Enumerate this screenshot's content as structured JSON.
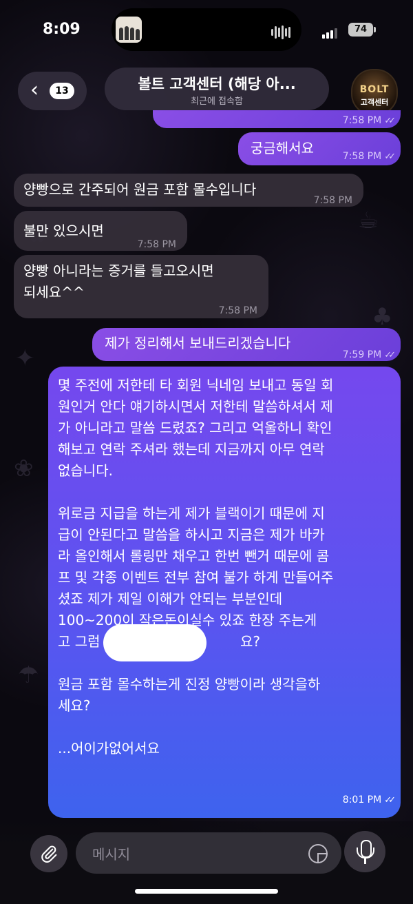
{
  "status_bar": {
    "time": "8:09",
    "battery": "74"
  },
  "header": {
    "back_count": "13",
    "title": "볼트 고객센터 (해당 아...",
    "subtitle": "최근에 접속함",
    "avatar_text_top": "BOLT",
    "avatar_text_bottom": "고객센터"
  },
  "messages": [
    {
      "dir": "out",
      "text": "",
      "time": "7:58 PM",
      "read": true
    },
    {
      "dir": "out",
      "text": "궁금해서요",
      "time": "7:58 PM",
      "read": true
    },
    {
      "dir": "in",
      "text": "양빵으로 간주되어 원금 포함 몰수입니다",
      "time": "7:58 PM"
    },
    {
      "dir": "in",
      "text": "불만 있으시면",
      "time": "7:58 PM"
    },
    {
      "dir": "in",
      "text_line1": "양빵 아니라는 증거를 들고오시면",
      "text_line2": "되세요^^",
      "time": "7:58 PM"
    },
    {
      "dir": "out",
      "text": "제가 정리해서 보내드리겠습니다",
      "time": "7:59 PM",
      "read": true
    },
    {
      "dir": "out",
      "paragraphs": [
        "몇 주전에 저한테 타 회원 닉네임 보내고 동일 회\n원인거 안다 얘기하시면서 저한테 말씀하셔서 제\n가 아니라고 말씀 드렸죠? 그리고 억울하니 확인\n해보고 연락 주셔라 했는데 지금까지 아무 연락\n없습니다.",
        "위로금 지급을 하는게 제가 블랙이기 때문에 지\n급이 안된다고 말씀을 하시고 지금은 제가 바카\n라 올인해서 롤링만 채우고 한번 뺀거 때문에 콤\n프 및 각종 이벤트 전부 참여 불가 하게 만들어주\n셨죠 제가 제일 이해가 안되는 부분인데\n100~200이 작은돈이실수 있죠 한장 주는게\n고 그럼                                요?",
        "원금 포함 몰수하는게 진정 양빵이라 생각을하\n세요?",
        "...어이가없어서요"
      ],
      "time": "8:01 PM",
      "read": true
    }
  ],
  "input": {
    "placeholder": "메시지"
  },
  "icons": {
    "back": "chevron-left-icon",
    "attach": "paperclip-icon",
    "sticker": "sticker-icon",
    "mic": "microphone-icon"
  },
  "colors": {
    "outgoing": "#7a4fe8",
    "incoming": "#342e38",
    "background": "#0b0910"
  }
}
